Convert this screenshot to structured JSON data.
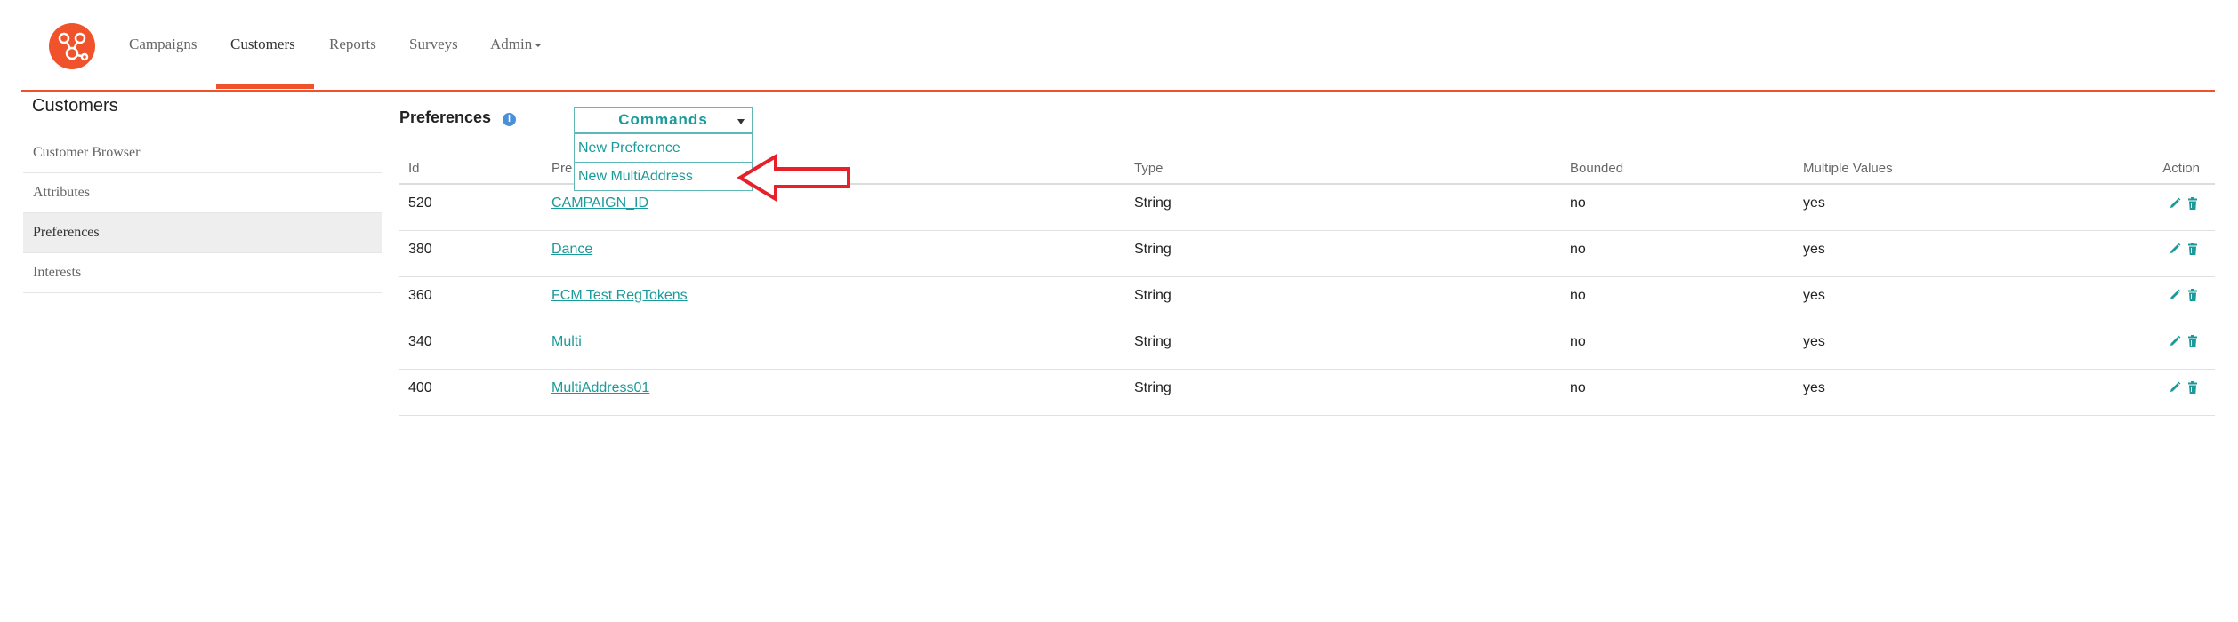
{
  "nav": {
    "items": [
      {
        "label": "Campaigns"
      },
      {
        "label": "Customers"
      },
      {
        "label": "Reports"
      },
      {
        "label": "Surveys"
      },
      {
        "label": "Admin"
      }
    ],
    "active": "Customers"
  },
  "sidebar": {
    "title": "Customers",
    "items": [
      {
        "label": "Customer Browser"
      },
      {
        "label": "Attributes"
      },
      {
        "label": "Preferences"
      },
      {
        "label": "Interests"
      }
    ],
    "active": "Preferences"
  },
  "main": {
    "title": "Preferences",
    "info_icon": "info-icon"
  },
  "commands": {
    "label": "Commands",
    "options": [
      {
        "label": "New Preference"
      },
      {
        "label": "New MultiAddress"
      }
    ]
  },
  "table": {
    "headers": {
      "id": "Id",
      "name": "Pre",
      "type": "Type",
      "bounded": "Bounded",
      "multiple": "Multiple Values",
      "action": "Action"
    },
    "rows": [
      {
        "id": "520",
        "name": "CAMPAIGN_ID",
        "type": "String",
        "bounded": "no",
        "multiple": "yes"
      },
      {
        "id": "380",
        "name": "Dance",
        "type": "String",
        "bounded": "no",
        "multiple": "yes"
      },
      {
        "id": "360",
        "name": "FCM Test RegTokens",
        "type": "String",
        "bounded": "no",
        "multiple": "yes"
      },
      {
        "id": "340",
        "name": "Multi",
        "type": "String",
        "bounded": "no",
        "multiple": "yes"
      },
      {
        "id": "400",
        "name": "MultiAddress01",
        "type": "String",
        "bounded": "no",
        "multiple": "yes"
      }
    ]
  },
  "colors": {
    "brand": "#f0532b",
    "link": "#1a9a9a",
    "annotation_arrow": "#e8202a"
  }
}
